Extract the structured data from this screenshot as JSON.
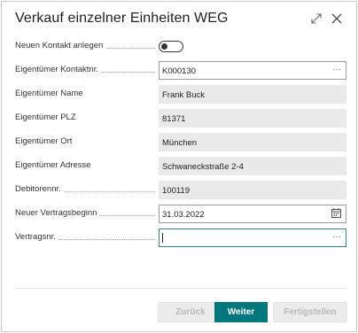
{
  "dialog": {
    "title": "Verkauf einzelner Einheiten WEG",
    "expand_icon": "expand-icon",
    "close_icon": "close-icon"
  },
  "fields": {
    "new_contact": {
      "label": "Neuen Kontakt anlegen",
      "value": false
    },
    "owner_contact_no": {
      "label": "Eigentümer Kontaktnr.",
      "value": "K000130",
      "action": "···"
    },
    "owner_name": {
      "label": "Eigentümer Name",
      "value": "Frank Buck"
    },
    "owner_zip": {
      "label": "Eigentümer PLZ",
      "value": "81371"
    },
    "owner_city": {
      "label": "Eigentümer Ort",
      "value": "München"
    },
    "owner_address": {
      "label": "Eigentümer Adresse",
      "value": "Schwaneckstraße 2-4"
    },
    "debtor_no": {
      "label": "Debitorennr.",
      "value": "100119"
    },
    "contract_start": {
      "label": "Neuer Vertragsbeginn",
      "value": "31.03.2022",
      "icon": "calendar-icon"
    },
    "contract_no": {
      "label": "Vertragsnr.",
      "value": "",
      "action": "···"
    }
  },
  "footer": {
    "back_label": "Zurück",
    "next_label": "Weiter",
    "finish_label": "Fertigstellen"
  },
  "colors": {
    "accent": "#00777c",
    "focus_border": "#2b8a8a",
    "readonly_bg": "#e9e9e9"
  }
}
